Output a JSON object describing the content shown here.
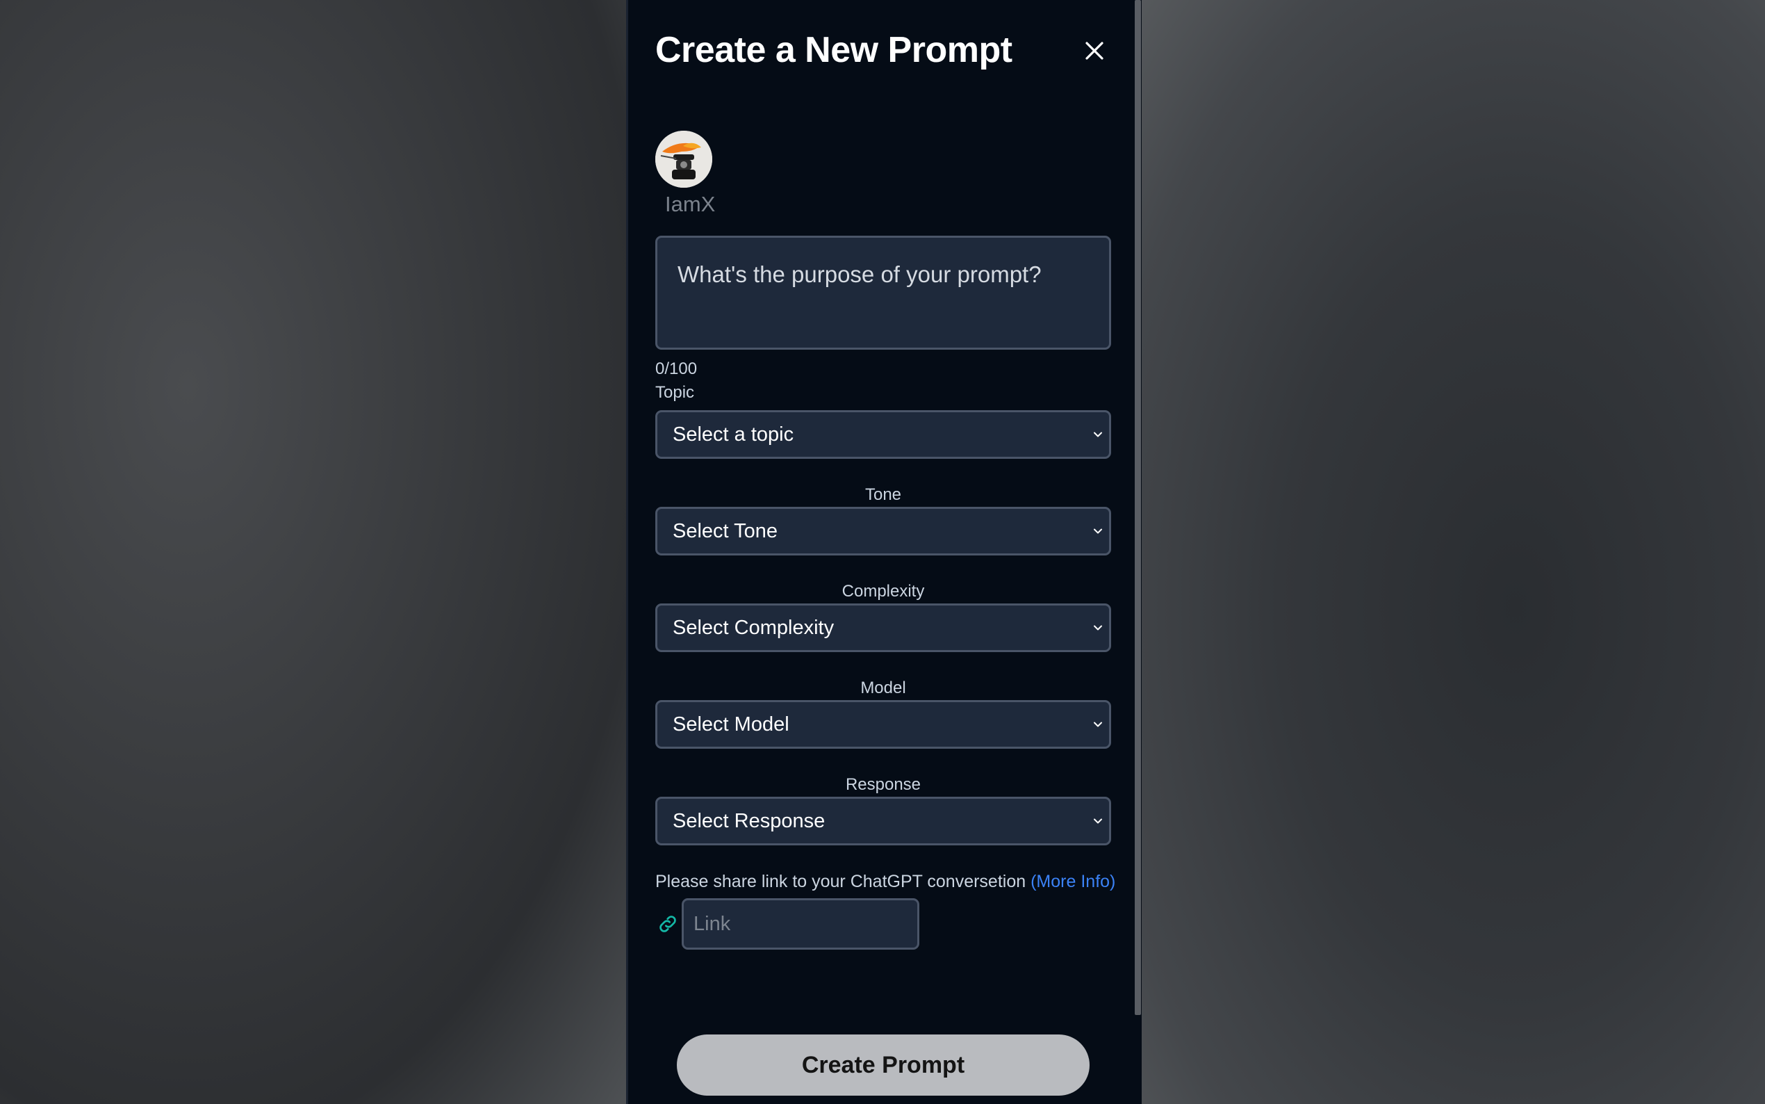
{
  "modal": {
    "title": "Create a New Prompt",
    "close_icon": "close-icon"
  },
  "user": {
    "name": "IamX",
    "avatar_icon": "avatar-image"
  },
  "purpose": {
    "placeholder": "What's the purpose of your prompt?",
    "value": "",
    "counter": "0/100"
  },
  "topic": {
    "label": "Topic",
    "selected": "Select a topic"
  },
  "tone": {
    "label": "Tone",
    "selected": "Select Tone"
  },
  "complexity": {
    "label": "Complexity",
    "selected": "Select Complexity"
  },
  "model": {
    "label": "Model",
    "selected": "Select Model"
  },
  "response": {
    "label": "Response",
    "selected": "Select Response"
  },
  "link": {
    "note": "Please share link to your ChatGPT conversetion",
    "more_info": "(More Info)",
    "placeholder": "Link",
    "icon": "link-icon"
  },
  "actions": {
    "create_label": "Create Prompt"
  },
  "colors": {
    "modal_bg": "#050c16",
    "field_bg": "#1e293b",
    "field_border": "#4a5568",
    "link_accent": "#3b82f6",
    "link_icon": "#14b8a6",
    "button_bg": "#b9bbbf"
  }
}
